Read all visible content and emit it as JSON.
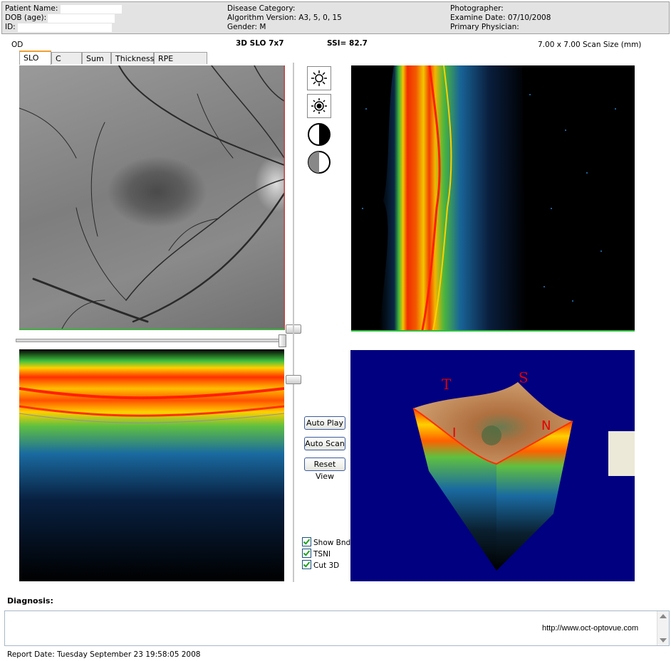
{
  "header": {
    "patient_name_label": "Patient Name: I",
    "dob_label": "DOB (age):",
    "id_label": "ID:",
    "disease_category": "Disease Category:",
    "algorithm_version": "Algorithm Version: A3, 5, 0, 15",
    "gender": "Gender: M",
    "photographer": "Photographer:",
    "examine_date": "Examine Date: 07/10/2008",
    "primary_physician": "Primary Physician:"
  },
  "scan_info": {
    "eye": "OD",
    "scan_type": "3D SLO 7x7",
    "ssi": "SSI= 82.7",
    "scan_size": "7.00 x 7.00 Scan Size (mm)"
  },
  "tabs": [
    "SLO",
    "C Scan",
    "Sum",
    "Thickness",
    "RPE Elevation"
  ],
  "active_tab": "SLO",
  "tool_icons": [
    "brightness-up-icon",
    "brightness-down-icon",
    "contrast-up-icon",
    "contrast-down-icon"
  ],
  "buttons": {
    "auto_play": "Auto Play",
    "auto_scan": "Auto Scan",
    "reset_view": "Reset View"
  },
  "checkboxes": [
    {
      "label": "Show Bnd",
      "checked": true
    },
    {
      "label": "TSNI",
      "checked": true
    },
    {
      "label": "Cut 3D",
      "checked": true
    }
  ],
  "view3d_labels": {
    "t": "T",
    "s": "S",
    "i": "I",
    "n": "N"
  },
  "diagnosis": {
    "label": "Diagnosis:",
    "url": "http://www.oct-optovue.com"
  },
  "footer": {
    "report_date": "Report Date: Tuesday September 23 19:58:05 2008"
  },
  "colors": {
    "header_bg": "#e3e3e3",
    "scan_hot": "#ff3000",
    "scan_warm": "#ffd000",
    "scan_mid": "#40c040",
    "scan_cool": "#1060c0",
    "view3d_bg": "#000080"
  }
}
